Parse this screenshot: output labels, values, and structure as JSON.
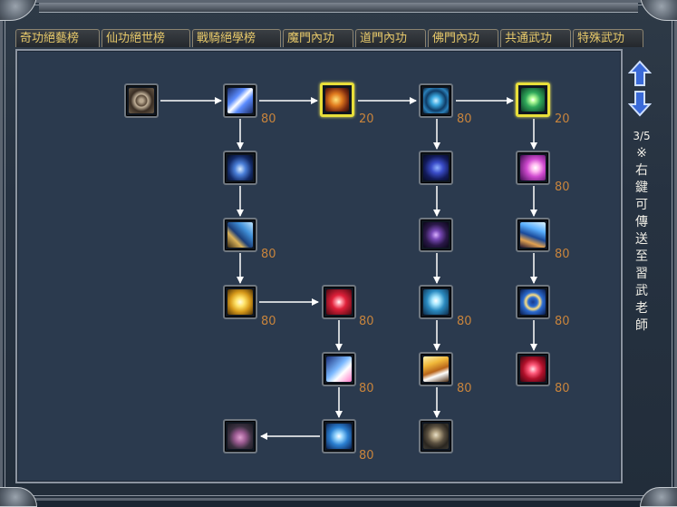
{
  "tabs": [
    "奇功絕藝榜",
    "仙功絕世榜",
    "戰騎絕學榜",
    "魔門內功",
    "道門內功",
    "佛門內功",
    "共通武功",
    "特殊武功"
  ],
  "pager": {
    "page": "3/5"
  },
  "hint": "※右鍵可傳送至習武老師",
  "colors": {
    "tab_text": "#e6c86a",
    "level_text": "#c8843c",
    "highlight": "#e8df3a",
    "panel": "#2b3a4e"
  },
  "skills": [
    {
      "id": "s1",
      "icon": "gear-wheel-icon",
      "level": "",
      "highlight": false
    },
    {
      "id": "s2",
      "icon": "blue-slash-icon",
      "level": "80",
      "highlight": false
    },
    {
      "id": "s3",
      "icon": "gold-swirl-icon",
      "level": "20",
      "highlight": true
    },
    {
      "id": "s4",
      "icon": "blue-vortex-icon",
      "level": "80",
      "highlight": false
    },
    {
      "id": "s5",
      "icon": "green-star-burst-icon",
      "level": "20",
      "highlight": true
    },
    {
      "id": "s6",
      "icon": "blue-spikes-icon",
      "level": "",
      "highlight": false
    },
    {
      "id": "s7",
      "icon": "chain-strike-icon",
      "level": "80",
      "highlight": false
    },
    {
      "id": "s8",
      "icon": "golden-cross-icon",
      "level": "80",
      "highlight": false
    },
    {
      "id": "s9",
      "icon": "red-burst-icon",
      "level": "80",
      "highlight": false
    },
    {
      "id": "s10",
      "icon": "comet-strike-icon",
      "level": "80",
      "highlight": false
    },
    {
      "id": "s11",
      "icon": "blue-hexagram-icon",
      "level": "80",
      "highlight": false
    },
    {
      "id": "s12",
      "icon": "lotus-icon",
      "level": "",
      "highlight": false
    },
    {
      "id": "s13",
      "icon": "blue-wave-icon",
      "level": "",
      "highlight": false
    },
    {
      "id": "s14",
      "icon": "purple-tentacle-icon",
      "level": "",
      "highlight": false
    },
    {
      "id": "s15",
      "icon": "ice-crown-icon",
      "level": "80",
      "highlight": false
    },
    {
      "id": "s16",
      "icon": "golden-wind-icon",
      "level": "80",
      "highlight": false
    },
    {
      "id": "s17",
      "icon": "meditating-monk-icon",
      "level": "",
      "highlight": false
    },
    {
      "id": "s18",
      "icon": "pink-orb-icon",
      "level": "80",
      "highlight": false
    },
    {
      "id": "s19",
      "icon": "blue-tornado-icon",
      "level": "80",
      "highlight": false
    },
    {
      "id": "s20",
      "icon": "gold-ring-icon",
      "level": "80",
      "highlight": false
    },
    {
      "id": "s21",
      "icon": "red-shield-icon",
      "level": "80",
      "highlight": false
    }
  ]
}
